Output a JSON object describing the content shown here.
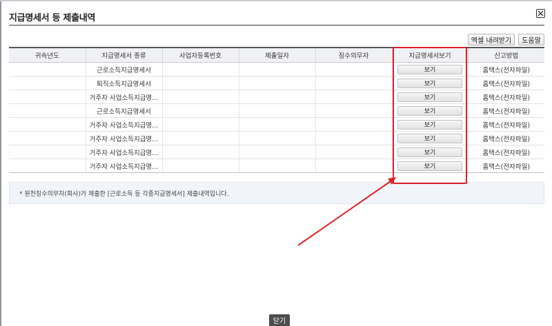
{
  "dialog": {
    "title": "지급명세서 등 제출내역",
    "close_label": "닫기"
  },
  "toolbar": {
    "excel_label": "엑셀 내려받기",
    "help_label": "도움말"
  },
  "table": {
    "headers": [
      "귀속년도",
      "지급명세서 종류",
      "사업자등록번호",
      "제출일자",
      "징수의무자",
      "지급명세서보기",
      "신고방법"
    ],
    "rows": [
      {
        "year": "",
        "type": "근로소득지급명세서",
        "bizno": "",
        "date": "",
        "payer": "",
        "view": "보기",
        "method": "홈택스(전자파일)"
      },
      {
        "year": "",
        "type": "퇴직소득지급명세서",
        "bizno": "",
        "date": "",
        "payer": "",
        "view": "보기",
        "method": "홈택스(전자파일)"
      },
      {
        "year": "",
        "type": "거주자 사업소득지급명...",
        "bizno": "",
        "date": "",
        "payer": "",
        "view": "보기",
        "method": "홈택스(전자파일)"
      },
      {
        "year": "",
        "type": "근로소득지급명세서",
        "bizno": "",
        "date": "",
        "payer": "",
        "view": "보기",
        "method": "홈택스(전자파일)"
      },
      {
        "year": "",
        "type": "거주자 사업소득지급명...",
        "bizno": "",
        "date": "",
        "payer": "",
        "view": "보기",
        "method": "홈택스(전자파일)"
      },
      {
        "year": "",
        "type": "거주자 사업소득지급명...",
        "bizno": "",
        "date": "",
        "payer": "",
        "view": "보기",
        "method": "홈택스(전자파일)"
      },
      {
        "year": "",
        "type": "거주자 사업소득지급명...",
        "bizno": "",
        "date": "",
        "payer": "",
        "view": "보기",
        "method": "홈택스(전자파일)"
      },
      {
        "year": "",
        "type": "거주자 사업소득지급명...",
        "bizno": "",
        "date": "",
        "payer": "",
        "view": "보기",
        "method": "홈택스(전자파일)"
      }
    ]
  },
  "notice": {
    "text": "* 원천징수의무자(회사)가 제출한 [근로소득 등 각종지급명세서] 제출내역입니다."
  },
  "annotation": {
    "color": "#e0202a",
    "icon": "red-arrow-icon"
  }
}
